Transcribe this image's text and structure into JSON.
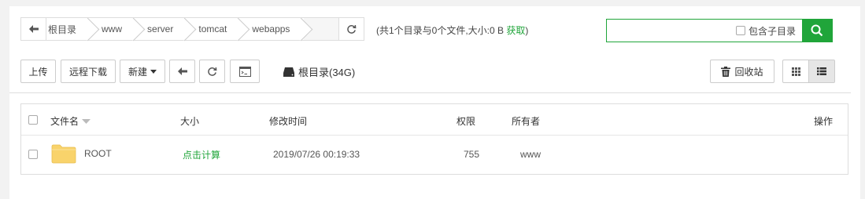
{
  "breadcrumb": {
    "items": [
      "根目录",
      "www",
      "server",
      "tomcat",
      "webapps"
    ]
  },
  "dir_info": {
    "text": "(共1个目录与0个文件,大小:0 B ",
    "fetch": "获取",
    "close": ")"
  },
  "search": {
    "placeholder": "",
    "include_subdirs": "包含子目录"
  },
  "toolbar": {
    "upload": "上传",
    "remote_download": "远程下载",
    "new": "新建",
    "disk_label": "根目录(34G)",
    "recycle_bin": "回收站"
  },
  "table": {
    "headers": {
      "name": "文件名",
      "size": "大小",
      "mtime": "修改时间",
      "perm": "权限",
      "owner": "所有者",
      "ops": "操作"
    },
    "rows": [
      {
        "name": "ROOT",
        "size": "点击计算",
        "mtime": "2019/07/26 00:19:33",
        "perm": "755",
        "owner": "www"
      }
    ]
  },
  "colors": {
    "accent": "#20a53a",
    "folder": "#f9d36b"
  }
}
